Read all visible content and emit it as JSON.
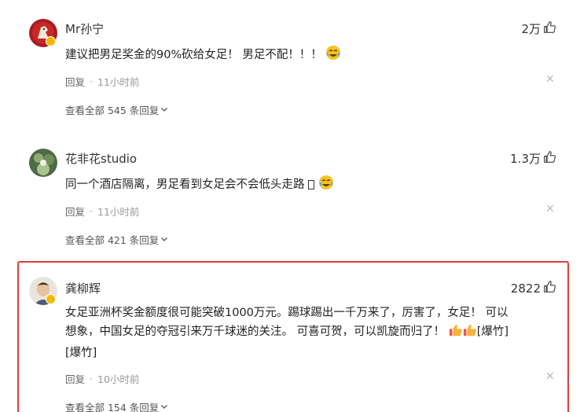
{
  "comments": [
    {
      "username": "Mr孙宁",
      "likes": "2万",
      "text": "建议把男足奖金的90%砍给女足！ 男足不配！！！",
      "reply_label": "回复",
      "time": "11小时前",
      "view_all": "查看全部 545 条回复"
    },
    {
      "username": "花非花studio",
      "likes": "1.3万",
      "text": "同一个酒店隔离，男足看到女足会不会低头走路",
      "reply_label": "回复",
      "time": "11小时前",
      "view_all": "查看全部 421 条回复"
    },
    {
      "username": "龚柳辉",
      "likes": "2822",
      "text_line1": "女足亚洲杯奖金额度很可能突破1000万元。踢球踢出一千万来了，厉害了，女足！ 可以",
      "text_line2a": "想象，中国女足的夺冠引来万千球迷的关注。 可喜可贺，可以凯旋而归了！",
      "text_line2b": "[爆竹]",
      "text_line3": "[爆竹]",
      "reply_label": "回复",
      "time": "10小时前",
      "view_all": "查看全部 154 条回复"
    }
  ],
  "edge_glyph": "i",
  "accent": "#e03a3a"
}
